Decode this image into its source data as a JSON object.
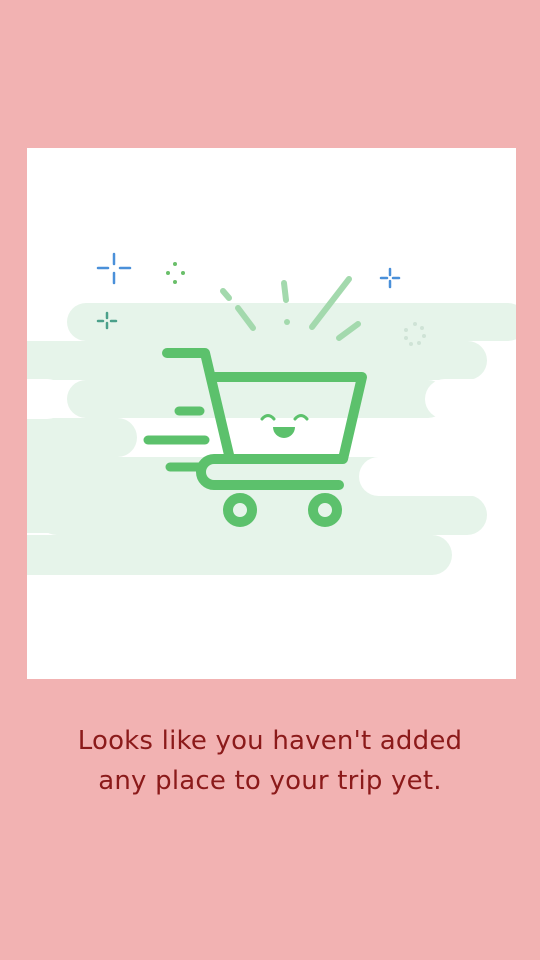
{
  "screen": {
    "background_color": "#f2b2b2"
  },
  "illustration": {
    "card_color": "#ffffff",
    "cloud_color": "#e6f4ea",
    "cart_color": "#5cc16c",
    "burst_color": "#a3d9ad",
    "sparkle_blue": "#4a90d9",
    "sparkle_green": "#6abf6a",
    "sparkle_teal": "#4aa08a",
    "icon": "shopping-cart-icon"
  },
  "message": {
    "line1": "Looks like you haven't added",
    "line2": "any place to your trip yet.",
    "color": "#8b1a1a"
  }
}
